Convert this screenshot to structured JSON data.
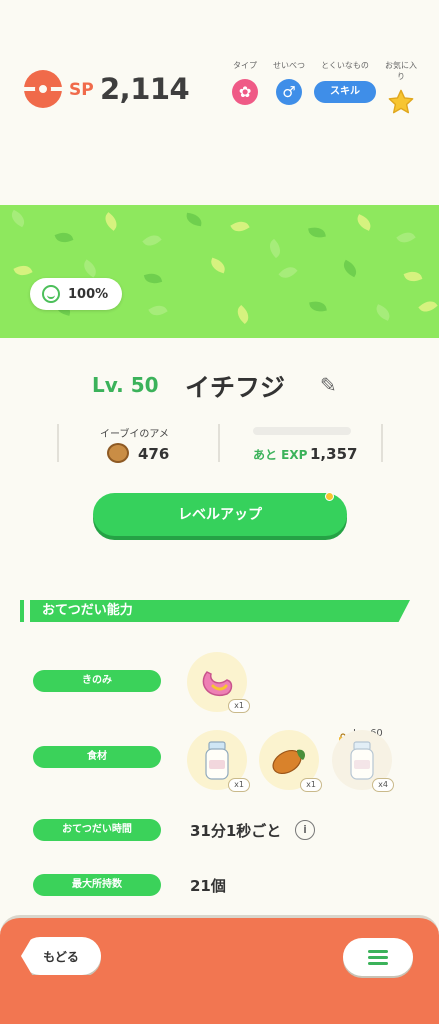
{
  "header": {
    "sp_label": "SP",
    "sp_value": "2,114",
    "type_caption": "タイプ",
    "gender_caption": "せいべつ",
    "specialty_caption": "とくいなもの",
    "favorite_caption": "お気に入り",
    "gender_symbol": "♂",
    "specialty_value": "スキル",
    "type_icon": "fairy-type-icon",
    "favorite_icon": "star-icon"
  },
  "banner": {
    "mood_value": "100%"
  },
  "profile": {
    "level": "Lv. 50",
    "name": "イチフジ"
  },
  "stats": {
    "candy_label": "イーブイのアメ",
    "candy_value": "476",
    "exp_label": "あと EXP",
    "exp_value": "1,357"
  },
  "level_up_label": "レベルアップ",
  "section_title": "おてつだい能力",
  "rows": {
    "berry_label": "きのみ",
    "berry_count": "x1",
    "ingredient_label": "食材",
    "ingredient_counts": [
      "x1",
      "x1",
      "x4"
    ],
    "locked_level": "Lv. 60",
    "help_time_label": "おてつだい時間",
    "help_time_value": "31分1秒ごと",
    "max_carry_label": "最大所持数",
    "max_carry_value": "21個"
  },
  "footer": {
    "back_label": "もどる"
  },
  "colors": {
    "accent_green": "#3bd25a",
    "pokeball_red": "#f06a4a",
    "footer_orange": "#f27651",
    "skill_blue": "#3f8ee8"
  }
}
